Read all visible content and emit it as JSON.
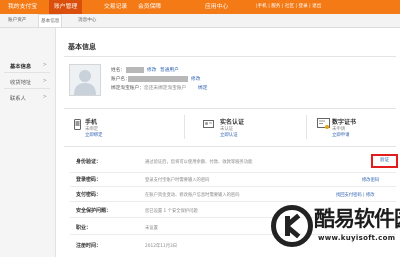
{
  "top_nav": {
    "items": [
      "我的支付宝",
      "账户管理",
      "交易记录",
      "会员保障",
      "应用中心"
    ],
    "utility": "|手机 | 服务 | 社区 | 登录 | 退出"
  },
  "sub_nav": {
    "items": [
      "账户资产",
      "基本信息",
      "消息中心"
    ]
  },
  "sidebar": {
    "items": [
      "基本信息",
      "收货地址",
      "联系人"
    ],
    "arrow": ">"
  },
  "page_title": "基本信息",
  "profile": {
    "name_label": "姓名：",
    "name_link": "修改",
    "verified_badge": "普通用户",
    "account_label": "账户名：",
    "account_link": "修改",
    "phone_label": "绑定淘宝账户：",
    "phone_text": "您还未绑定淘宝账户",
    "phone_link": "绑定"
  },
  "cards": [
    {
      "title": "手机",
      "status": "未绑定",
      "link": "立即绑定"
    },
    {
      "title": "实名认证",
      "status": "未认证",
      "link": "立即认证"
    },
    {
      "title": "数字证书",
      "status": "未申请",
      "link": "立即申请"
    }
  ],
  "rows": [
    {
      "label": "身份验证：",
      "desc": "通过验证后，您将可以使用余额、付款、收款等服务功能",
      "action": "验证"
    },
    {
      "label": "登录密码：",
      "desc": "登录支付宝账户时需要输入的密码",
      "action": "修改密码"
    },
    {
      "label": "支付密码：",
      "desc": "在账户资金变动、修改账户信息时需要输入的密码",
      "action": "找回支付密码 | 修改"
    },
    {
      "label": "安全保护问题：",
      "desc": "您已设置 1 个安全保护问题",
      "action": "修改"
    },
    {
      "label": "职业：",
      "desc": "未设置",
      "action": "设置"
    },
    {
      "label": "注册时间：",
      "desc": "2012年11月3日",
      "action": ""
    }
  ],
  "watermark": {
    "brand": "酷易软件园",
    "url": "www.kuyisoft.com"
  }
}
